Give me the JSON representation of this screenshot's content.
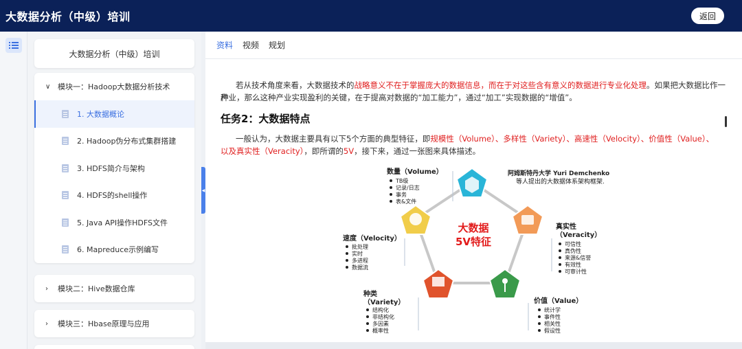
{
  "topbar": {
    "title": "大数据分析（中级）培训",
    "back_label": "返回"
  },
  "sidebar": {
    "course_title": "大数据分析（中级）培训",
    "modules": [
      {
        "label": "模块一：Hadoop大数据分析技术",
        "expanded": true,
        "lessons": [
          "1. 大数据概论",
          "2. Hadoop伪分布式集群搭建",
          "3. HDFS简介与架构",
          "4. HDFS的shell操作",
          "5. Java API操作HDFS文件",
          "6. Mapreduce示例编写"
        ]
      },
      {
        "label": "模块二：Hive数据仓库",
        "expanded": false
      },
      {
        "label": "模块三：Hbase原理与应用",
        "expanded": false
      }
    ]
  },
  "tabs": [
    "资料",
    "视频",
    "规划"
  ],
  "content": {
    "para1_a": "若从技术角度来看，大数据技术的",
    "para1_red": "战略意义不在于掌握庞大的数据信息，而在于对这些含有意义的数据进行专业化处理",
    "para1_b": "。如果把大数据比作一种",
    "para1_line2": "产业，那么这种产业实现盈利的关键，在于提高对数据的“加工能力”，通过“加工”实现数据的“增值”。",
    "heading": "任务2：大数据特点",
    "para2_a": "一般认为，大数据主要具有以下5个方面的典型特征，即",
    "para2_red1": "规模性（Volume）、多样性（Variety）、高速性（Velocity）、价值性（Value）、",
    "para2_red2": "以及真实性（Veracity）",
    "para2_b": "，即所谓的",
    "para2_red3": "5V",
    "para2_c": "，接下来，通过一张图来具体描述。"
  },
  "figure": {
    "center_line1": "大数据",
    "center_line2": "5V特征",
    "source_line1": "阿姆斯特丹大学 Yuri Demchenko",
    "source_line2": "等人提出的大数据体系架构框架.",
    "volume_title": "数量（Volume）",
    "volume_items": [
      "TB级",
      "记录/日志",
      "事务",
      "表&文件"
    ],
    "velocity_title": "速度（Velocity）",
    "velocity_items": [
      "批处理",
      "实时",
      "多进程",
      "数据流"
    ],
    "veracity_title1": "真实性",
    "veracity_title2": "（Veracity）",
    "veracity_items": [
      "可信性",
      "真伪性",
      "来源&信誉",
      "有效性",
      "可审计性"
    ],
    "variety_title1": "种类",
    "variety_title2": "（Variety）",
    "variety_items": [
      "结构化",
      "非结构化",
      "多因素",
      "概率性"
    ],
    "value_title": "价值（Value）",
    "value_items": [
      "统计学",
      "事件性",
      "相关性",
      "假设性"
    ],
    "colors": {
      "volume": "#29b5d8",
      "veracity": "#f29a57",
      "value": "#3a9a4a",
      "variety": "#e0532c",
      "velocity": "#f1cd4a",
      "center": "#e21b1b"
    }
  }
}
